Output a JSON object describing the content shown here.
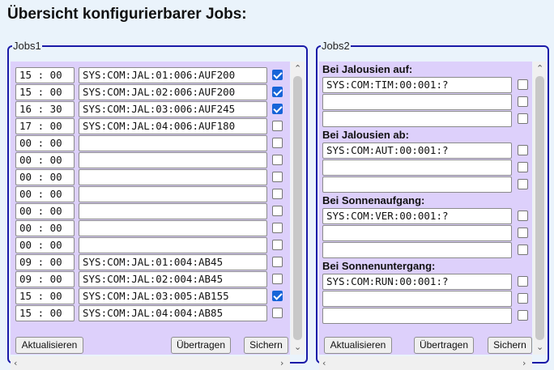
{
  "page": {
    "title": "Übersicht konfigurierbarer Jobs:"
  },
  "jobs1": {
    "legend": "Jobs1",
    "rows": [
      {
        "time": "15 : 00",
        "command": "SYS:COM:JAL:01:006:AUF200",
        "checked": true
      },
      {
        "time": "15 : 00",
        "command": "SYS:COM:JAL:02:006:AUF200",
        "checked": true
      },
      {
        "time": "16 : 30",
        "command": "SYS:COM:JAL:03:006:AUF245",
        "checked": true
      },
      {
        "time": "17 : 00",
        "command": "SYS:COM:JAL:04:006:AUF180",
        "checked": false
      },
      {
        "time": "00 : 00",
        "command": "",
        "checked": false
      },
      {
        "time": "00 : 00",
        "command": "",
        "checked": false
      },
      {
        "time": "00 : 00",
        "command": "",
        "checked": false
      },
      {
        "time": "00 : 00",
        "command": "",
        "checked": false
      },
      {
        "time": "00 : 00",
        "command": "",
        "checked": false
      },
      {
        "time": "00 : 00",
        "command": "",
        "checked": false
      },
      {
        "time": "00 : 00",
        "command": "",
        "checked": false
      },
      {
        "time": "09 : 00",
        "command": "SYS:COM:JAL:01:004:AB45",
        "checked": false
      },
      {
        "time": "09 : 00",
        "command": "SYS:COM:JAL:02:004:AB45",
        "checked": false
      },
      {
        "time": "15 : 00",
        "command": "SYS:COM:JAL:03:005:AB155",
        "checked": true
      },
      {
        "time": "15 : 00",
        "command": "SYS:COM:JAL:04:004:AB85",
        "checked": false
      }
    ],
    "buttons": {
      "refresh": "Aktualisieren",
      "transfer": "Übertragen",
      "save": "Sichern"
    }
  },
  "jobs2": {
    "legend": "Jobs2",
    "sections": [
      {
        "label": "Bei Jalousien auf:",
        "entries": [
          "SYS:COM:TIM:00:001:?",
          "",
          ""
        ]
      },
      {
        "label": "Bei Jalousien ab:",
        "entries": [
          "SYS:COM:AUT:00:001:?",
          "",
          ""
        ]
      },
      {
        "label": "Bei Sonnenaufgang:",
        "entries": [
          "SYS:COM:VER:00:001:?",
          "",
          ""
        ]
      },
      {
        "label": "Bei Sonnenuntergang:",
        "entries": [
          "SYS:COM:RUN:00:001:?",
          "",
          ""
        ]
      }
    ],
    "buttons": {
      "refresh": "Aktualisieren",
      "transfer": "Übertragen",
      "save": "Sichern"
    }
  },
  "icons": {
    "scroll_up": "chevron-up-icon",
    "scroll_down": "chevron-down-icon",
    "scroll_left": "chevron-left-icon",
    "scroll_right": "chevron-right-icon"
  },
  "colors": {
    "frame": "#1a1aa8",
    "panel": "#ddd0fb",
    "checkbox_checked": "#1664d8",
    "background": "#eaf3fb"
  }
}
